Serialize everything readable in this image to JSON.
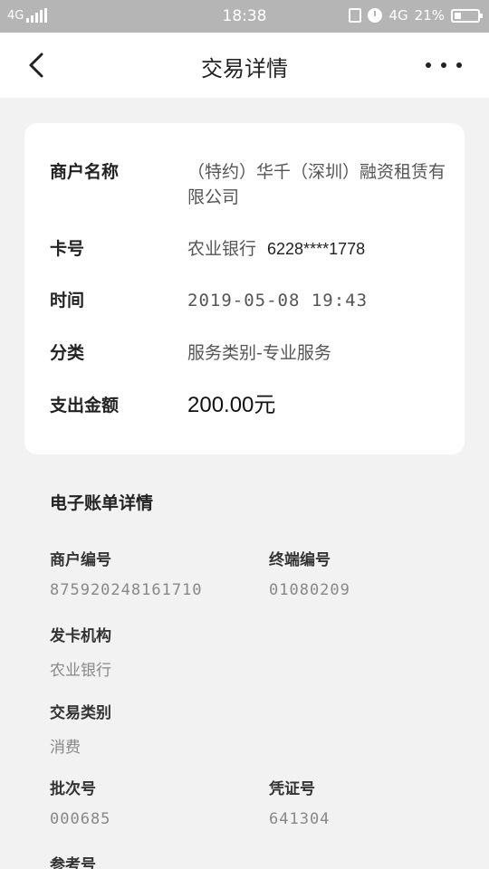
{
  "status_bar": {
    "network_left": "4G",
    "time": "18:38",
    "network_right": "4G",
    "battery": "21%"
  },
  "nav": {
    "title": "交易详情"
  },
  "transaction": {
    "merchant_label": "商户名称",
    "merchant_value": "（特约）华千（深圳）融资租赁有限公司",
    "card_label": "卡号",
    "card_bank": "农业银行",
    "card_number": "6228****1778",
    "time_label": "时间",
    "time_value": "2019-05-08 19:43",
    "category_label": "分类",
    "category_value": "服务类别-专业服务",
    "amount_label": "支出金额",
    "amount_value": "200.00元"
  },
  "bill": {
    "title": "电子账单详情",
    "merchant_no_label": "商户编号",
    "merchant_no_value": "875920248161710",
    "terminal_no_label": "终端编号",
    "terminal_no_value": "01080209",
    "issuer_label": "发卡机构",
    "issuer_value": "农业银行",
    "trans_type_label": "交易类别",
    "trans_type_value": "消费",
    "batch_no_label": "批次号",
    "batch_no_value": "000685",
    "voucher_no_label": "凭证号",
    "voucher_no_value": "641304",
    "reference_no_label": "参考号"
  }
}
